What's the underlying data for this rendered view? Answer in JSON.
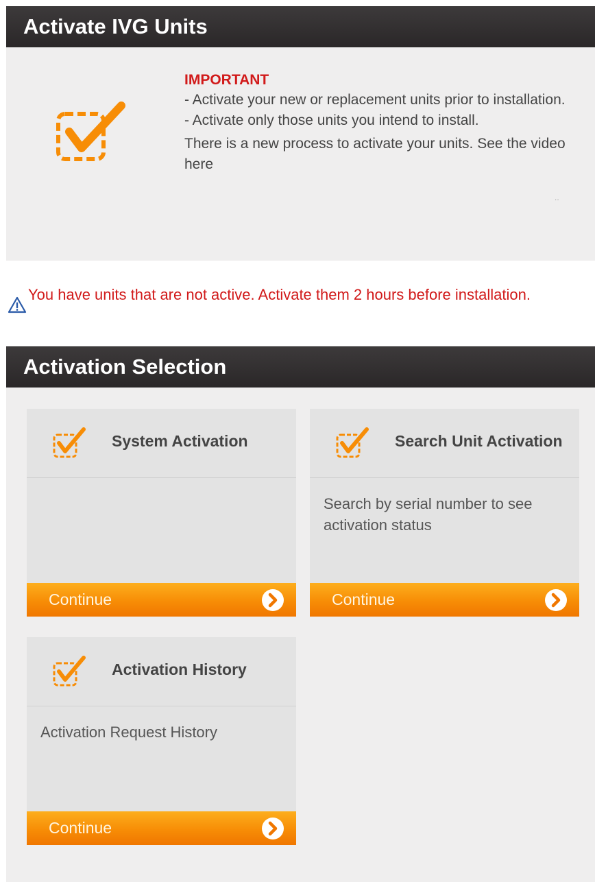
{
  "header": {
    "title": "Activate IVG Units"
  },
  "notice": {
    "title": "IMPORTANT",
    "lines": [
      "- Activate your new or replacement units prior to installation.",
      "- Activate only those units you intend to install."
    ],
    "process_text": "There is a new process to activate your units. See the video here",
    "dots": ".."
  },
  "warning": {
    "text": "You have units that are not active. Activate them 2 hours before installation."
  },
  "selection": {
    "title": "Activation Selection",
    "cards": [
      {
        "title": "System Activation",
        "description": "",
        "button_label": "Continue"
      },
      {
        "title": "Search Unit Activation",
        "description": "Search by serial number to see activation status",
        "button_label": "Continue"
      },
      {
        "title": "Activation History",
        "description": "Activation Request History",
        "button_label": "Continue"
      }
    ]
  },
  "colors": {
    "accent_orange": "#f78d06",
    "header_dark": "#2f2c2d",
    "alert_red": "#d11a1a",
    "warning_blue": "#2a5aa8"
  },
  "icons": {
    "checkbox": "checkbox-checked-icon",
    "warning": "warning-triangle-icon",
    "arrow": "arrow-right-circle-icon"
  }
}
